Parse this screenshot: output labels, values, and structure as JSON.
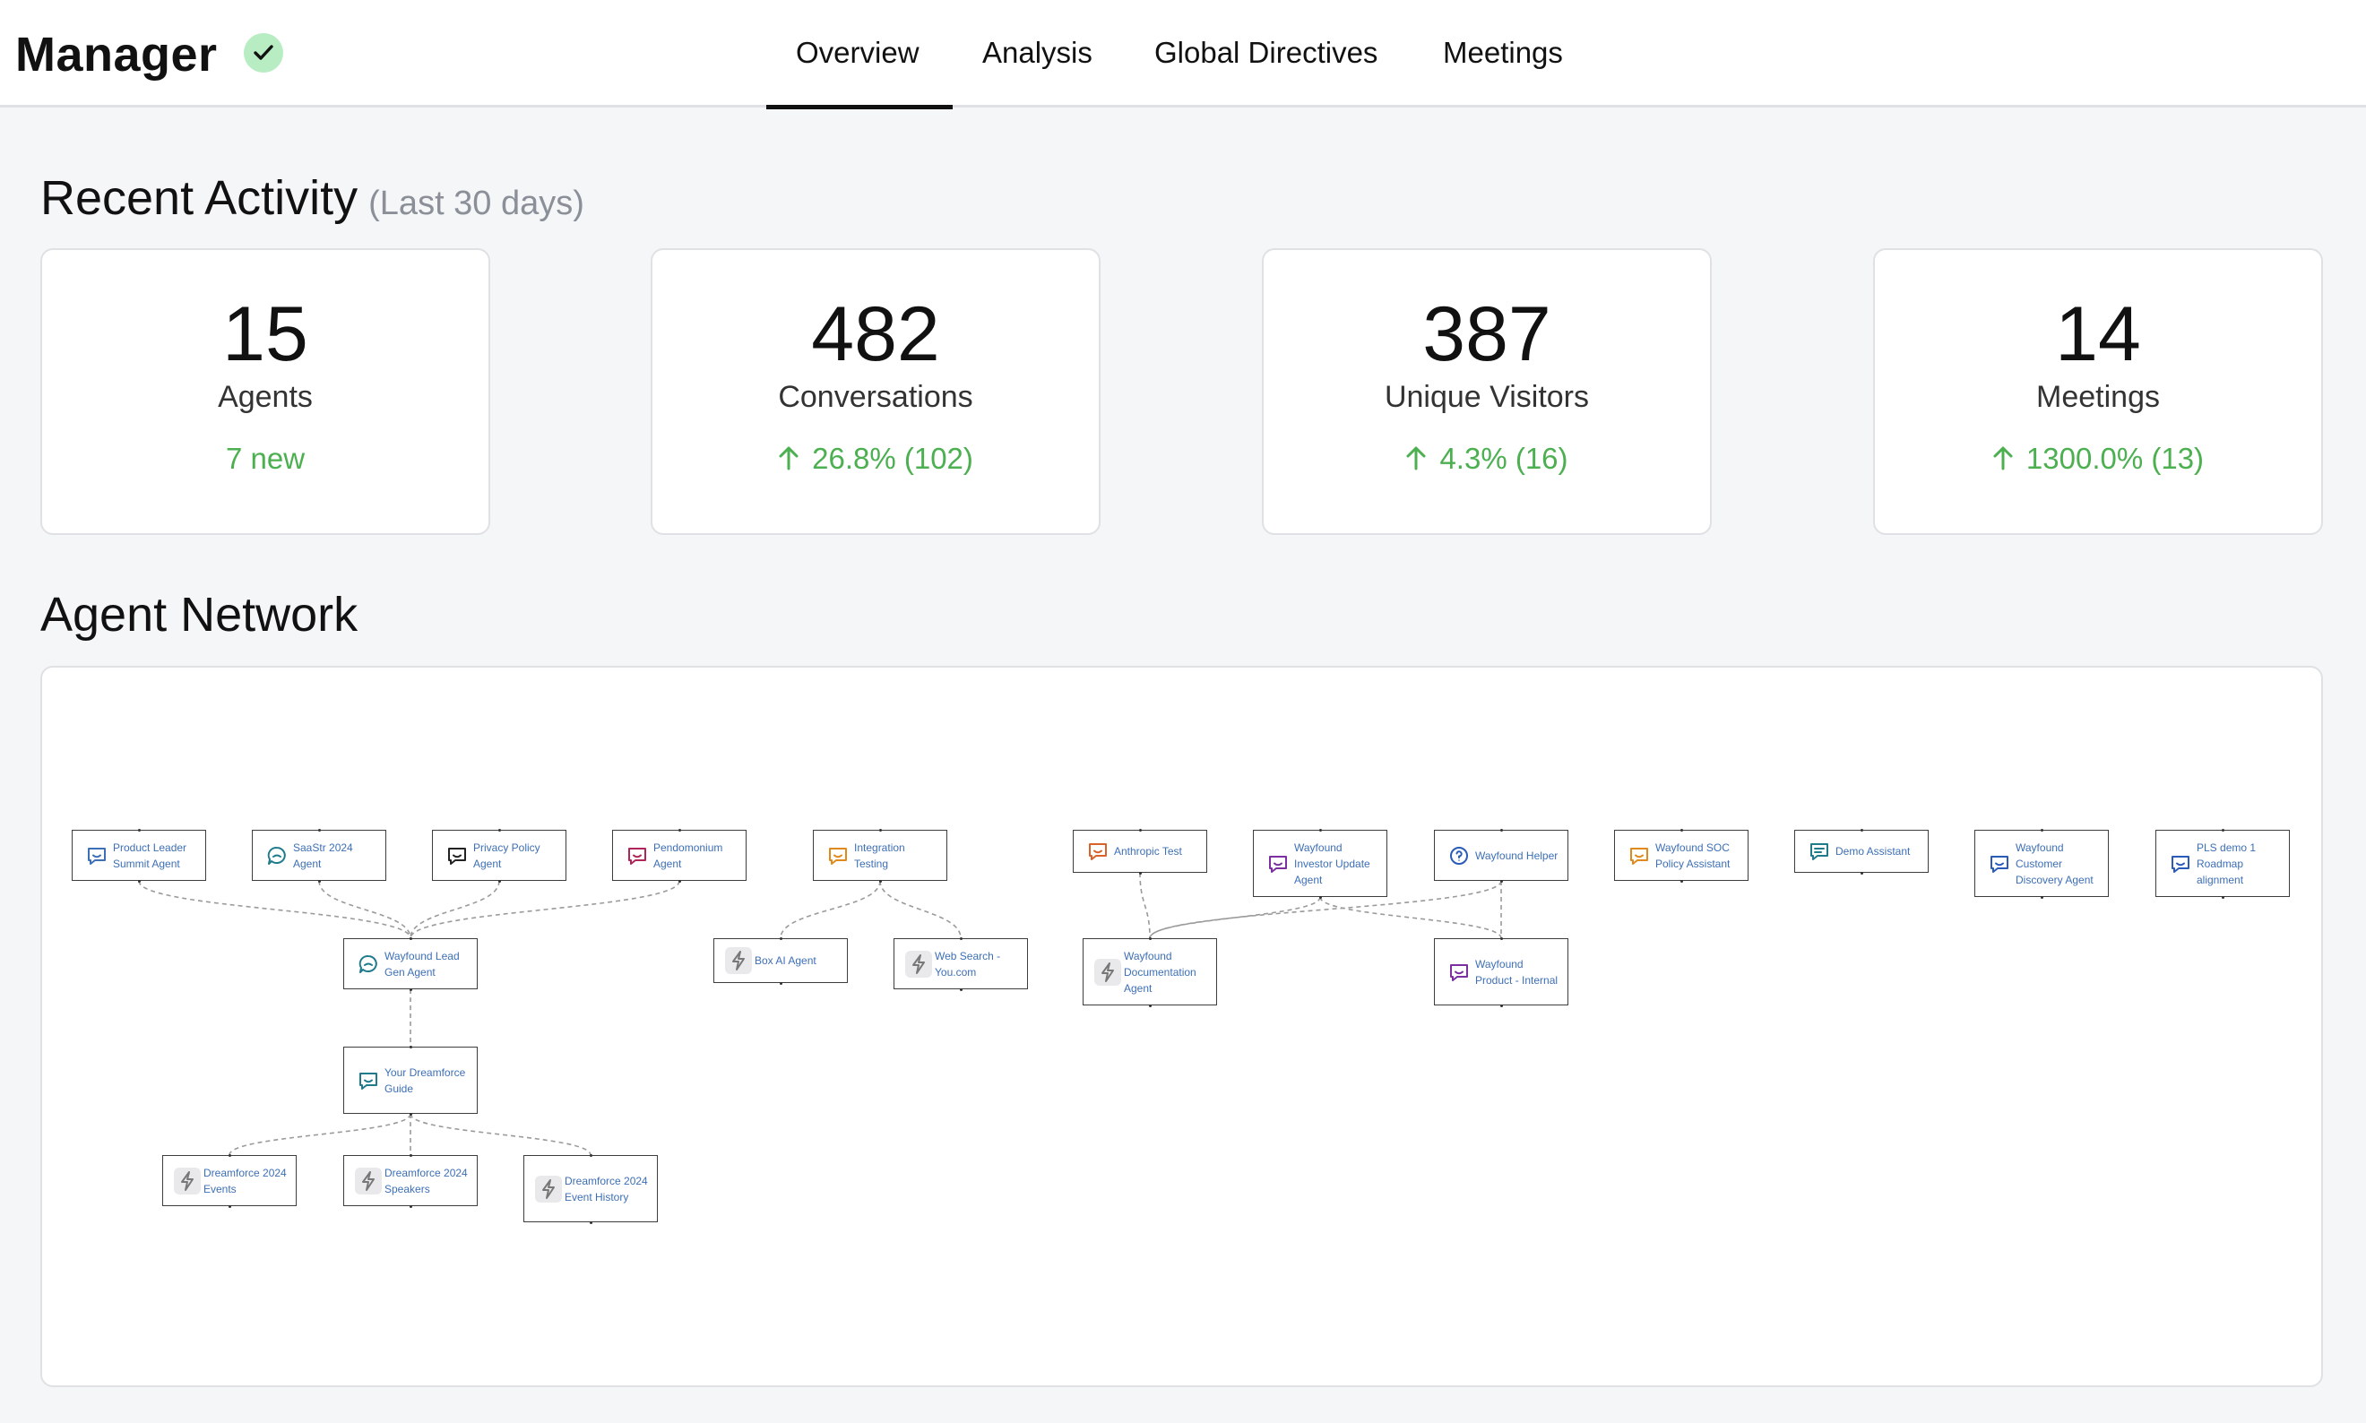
{
  "app": {
    "title": "Manager"
  },
  "tabs": [
    {
      "label": "Overview",
      "active": true
    },
    {
      "label": "Analysis"
    },
    {
      "label": "Global Directives"
    },
    {
      "label": "Meetings"
    }
  ],
  "recent_activity": {
    "title": "Recent Activity",
    "subtitle": "(Last 30 days)",
    "stats": [
      {
        "value": "15",
        "label": "Agents",
        "change": "7 new",
        "arrow": false
      },
      {
        "value": "482",
        "label": "Conversations",
        "change": "26.8% (102)",
        "arrow": true
      },
      {
        "value": "387",
        "label": "Unique Visitors",
        "change": "4.3% (16)",
        "arrow": true
      },
      {
        "value": "14",
        "label": "Meetings",
        "change": "1300.0% (13)",
        "arrow": true
      }
    ]
  },
  "agent_network": {
    "title": "Agent Network",
    "nodes": [
      {
        "id": "n1",
        "label": "Product Leader Summit Agent",
        "icon": "chat-smile-icon",
        "color": "#3d6fb6"
      },
      {
        "id": "n2",
        "label": "SaaStr 2024 Agent",
        "icon": "chat-bubble-icon",
        "color": "#1f7a8c"
      },
      {
        "id": "n3",
        "label": "Privacy Policy Agent",
        "icon": "chat-smile-icon",
        "color": "#222222"
      },
      {
        "id": "n4",
        "label": "Pendomonium Agent",
        "icon": "chat-smile-icon",
        "color": "#b0245a"
      },
      {
        "id": "n5",
        "label": "Integration Testing",
        "icon": "chat-smile-icon",
        "color": "#e08a1e"
      },
      {
        "id": "n6",
        "label": "Anthropic Test",
        "icon": "chat-smile-icon",
        "color": "#d9622b"
      },
      {
        "id": "n7",
        "label": "Wayfound Investor Update Agent",
        "icon": "chat-smile-icon",
        "color": "#7b2fa0"
      },
      {
        "id": "n8",
        "label": "Wayfound Helper",
        "icon": "help-circle-icon",
        "color": "#2a5bb8"
      },
      {
        "id": "n9",
        "label": "Wayfound SOC Policy Assistant",
        "icon": "chat-smile-icon",
        "color": "#e08a1e"
      },
      {
        "id": "n10",
        "label": "Demo Assistant",
        "icon": "chat-lines-icon",
        "color": "#1f7a8c"
      },
      {
        "id": "n11",
        "label": "Wayfound Customer Discovery Agent",
        "icon": "chat-smile-icon",
        "color": "#2a5bb8"
      },
      {
        "id": "n12",
        "label": "PLS demo 1 Roadmap alignment",
        "icon": "chat-smile-icon",
        "color": "#2a5bb8"
      },
      {
        "id": "n13",
        "label": "Wayfound Lead Gen Agent",
        "icon": "chat-bubble-icon",
        "color": "#1f7a8c"
      },
      {
        "id": "n14",
        "label": "Box AI Agent",
        "icon": "bolt-icon",
        "color": "#777777"
      },
      {
        "id": "n15",
        "label": "Web Search - You.com",
        "icon": "bolt-icon",
        "color": "#777777"
      },
      {
        "id": "n16",
        "label": "Wayfound Documentation Agent",
        "icon": "bolt-icon",
        "color": "#777777"
      },
      {
        "id": "n17",
        "label": "Wayfound Product - Internal",
        "icon": "chat-smile-icon",
        "color": "#7b2fa0"
      },
      {
        "id": "n18",
        "label": "Your Dreamforce Guide",
        "icon": "chat-smile-icon",
        "color": "#1f7a8c"
      },
      {
        "id": "n19",
        "label": "Dreamforce 2024 Events",
        "icon": "bolt-icon",
        "color": "#777777"
      },
      {
        "id": "n20",
        "label": "Dreamforce 2024 Speakers",
        "icon": "bolt-icon",
        "color": "#777777"
      },
      {
        "id": "n21",
        "label": "Dreamforce 2024 Event History",
        "icon": "bolt-icon",
        "color": "#777777"
      }
    ],
    "edges": [
      [
        "n1",
        "n13"
      ],
      [
        "n2",
        "n13"
      ],
      [
        "n3",
        "n13"
      ],
      [
        "n4",
        "n13"
      ],
      [
        "n13",
        "n18"
      ],
      [
        "n18",
        "n19"
      ],
      [
        "n18",
        "n20"
      ],
      [
        "n18",
        "n21"
      ],
      [
        "n5",
        "n14"
      ],
      [
        "n5",
        "n15"
      ],
      [
        "n6",
        "n16"
      ],
      [
        "n7",
        "n16"
      ],
      [
        "n8",
        "n16"
      ],
      [
        "n7",
        "n17"
      ],
      [
        "n8",
        "n17"
      ]
    ]
  }
}
